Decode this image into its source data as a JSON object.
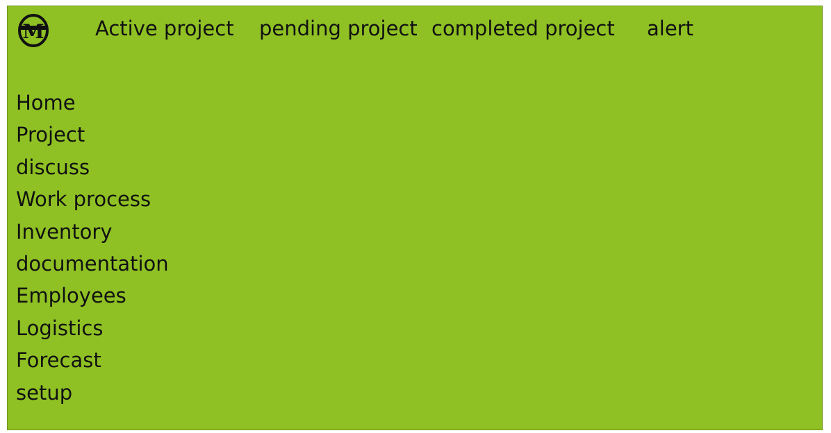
{
  "logo": {
    "icon": "m-logo-icon",
    "text": "M"
  },
  "top_nav": {
    "items": [
      {
        "label": "Active project"
      },
      {
        "label": "pending project"
      },
      {
        "label": "completed project"
      },
      {
        "label": "alert"
      }
    ]
  },
  "sidebar": {
    "items": [
      {
        "label": "Home"
      },
      {
        "label": "Project"
      },
      {
        "label": "discuss"
      },
      {
        "label": "Work process"
      },
      {
        "label": "Inventory"
      },
      {
        "label": "documentation"
      },
      {
        "label": "Employees"
      },
      {
        "label": "Logistics"
      },
      {
        "label": "Forecast"
      },
      {
        "label": "setup"
      }
    ]
  },
  "colors": {
    "background": "#8fc124",
    "text": "#111111"
  }
}
